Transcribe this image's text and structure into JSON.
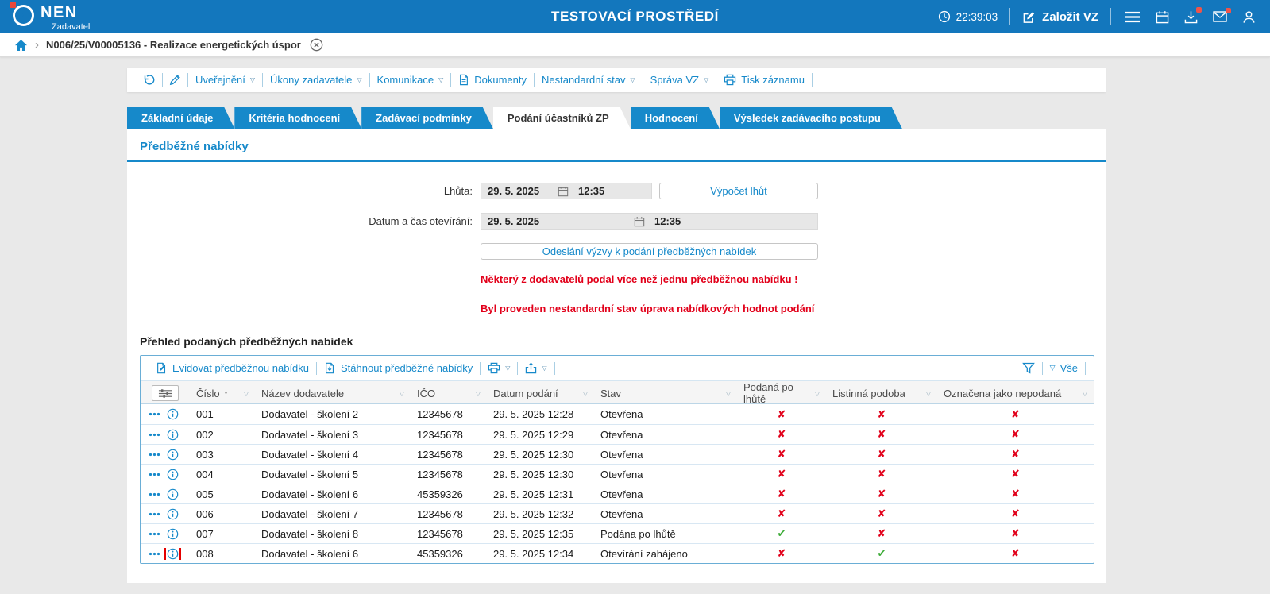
{
  "colors": {
    "header_bg": "#1377bd",
    "accent_blue": "#1689ca",
    "warning_red": "#e2001a",
    "check_green": "#3aaa35",
    "cross_red": "#e2001a",
    "highlight_box_red": "#e40000",
    "badge_red": "#f0544a"
  },
  "header": {
    "brand": "NEN",
    "brand_role": "Zadavatel",
    "environment_title": "TESTOVACÍ PROSTŘEDÍ",
    "clock": "22:39:03",
    "create_vz_label": "Založit VZ"
  },
  "breadcrumb": {
    "separator": "›",
    "record": "N006/25/V00005136 - Realizace energetických úspor"
  },
  "record_toolbar": {
    "items": [
      {
        "id": "uverejneni",
        "label": "Uveřejnění",
        "dropdown": true
      },
      {
        "id": "ukony-zadavatele",
        "label": "Úkony zadavatele",
        "dropdown": true
      },
      {
        "id": "komunikace",
        "label": "Komunikace",
        "dropdown": true
      },
      {
        "id": "dokumenty",
        "label": "Dokumenty",
        "icon": "document"
      },
      {
        "id": "nestandardni-stav",
        "label": "Nestandardní stav",
        "dropdown": true
      },
      {
        "id": "sprava-vz",
        "label": "Správa VZ",
        "dropdown": true
      },
      {
        "id": "tisk-zaznamu",
        "label": "Tisk záznamu",
        "icon": "printer"
      }
    ]
  },
  "tabs": [
    {
      "id": "zakladni-udaje",
      "label": "Základní údaje",
      "active": false
    },
    {
      "id": "kriteria-hodnoceni",
      "label": "Kritéria hodnocení",
      "active": false
    },
    {
      "id": "zadavaci-podminky",
      "label": "Zadávací podmínky",
      "active": false
    },
    {
      "id": "podani-ucastniku-zp",
      "label": "Podání účastníků ZP",
      "active": true
    },
    {
      "id": "hodnoceni",
      "label": "Hodnocení",
      "active": false
    },
    {
      "id": "vysledek-zadavaciho-postupu",
      "label": "Výsledek zadávacího postupu",
      "active": false
    }
  ],
  "preliminary_offers": {
    "section_title": "Předběžné nabídky",
    "deadline": {
      "label": "Lhůta:",
      "date": "29. 5. 2025",
      "time": "12:35"
    },
    "calc_deadlines_button": "Výpočet lhůt",
    "opening": {
      "label": "Datum a čas otevírání:",
      "date": "29. 5. 2025",
      "time": "12:35"
    },
    "send_call_button": "Odeslání výzvy k podání předběžných nabídek",
    "warnings": [
      "Některý z dodavatelů podal více než jednu předběžnou nabídku !",
      "Byl proveden nestandardní stav úprava nabídkových hodnot podání"
    ]
  },
  "offers_table": {
    "title": "Přehled podaných předběžných nabídek",
    "toolbar": {
      "register_label": "Evidovat předběžnou nabídku",
      "download_label": "Stáhnout předběžné nabídky",
      "all_label": "Vše"
    },
    "columns": [
      {
        "id": "cislo",
        "label": "Číslo",
        "sorted": "asc"
      },
      {
        "id": "nazev-dodavatele",
        "label": "Název dodavatele"
      },
      {
        "id": "ico",
        "label": "IČO"
      },
      {
        "id": "datum-podani",
        "label": "Datum podání"
      },
      {
        "id": "stav",
        "label": "Stav"
      },
      {
        "id": "podana-po-lhute",
        "label": "Podaná po lhůtě"
      },
      {
        "id": "listinna-podoba",
        "label": "Listinná podoba"
      },
      {
        "id": "oznacena-jako-nepodana",
        "label": "Označena jako nepodaná"
      }
    ],
    "rows": [
      {
        "number": "001",
        "supplier": "Dodavatel - školení 2",
        "ico": "12345678",
        "submitted": "29. 5. 2025 12:28",
        "status": "Otevřena",
        "late": false,
        "paper": false,
        "not_submitted": false
      },
      {
        "number": "002",
        "supplier": "Dodavatel - školení 3",
        "ico": "12345678",
        "submitted": "29. 5. 2025 12:29",
        "status": "Otevřena",
        "late": false,
        "paper": false,
        "not_submitted": false
      },
      {
        "number": "003",
        "supplier": "Dodavatel - školení 4",
        "ico": "12345678",
        "submitted": "29. 5. 2025 12:30",
        "status": "Otevřena",
        "late": false,
        "paper": false,
        "not_submitted": false
      },
      {
        "number": "004",
        "supplier": "Dodavatel - školení 5",
        "ico": "12345678",
        "submitted": "29. 5. 2025 12:30",
        "status": "Otevřena",
        "late": false,
        "paper": false,
        "not_submitted": false
      },
      {
        "number": "005",
        "supplier": "Dodavatel - školení 6",
        "ico": "45359326",
        "submitted": "29. 5. 2025 12:31",
        "status": "Otevřena",
        "late": false,
        "paper": false,
        "not_submitted": false
      },
      {
        "number": "006",
        "supplier": "Dodavatel - školení 7",
        "ico": "12345678",
        "submitted": "29. 5. 2025 12:32",
        "status": "Otevřena",
        "late": false,
        "paper": false,
        "not_submitted": false
      },
      {
        "number": "007",
        "supplier": "Dodavatel - školení 8",
        "ico": "12345678",
        "submitted": "29. 5. 2025 12:35",
        "status": "Podána po lhůtě",
        "late": true,
        "paper": false,
        "not_submitted": false
      },
      {
        "number": "008",
        "supplier": "Dodavatel - školení 6",
        "ico": "45359326",
        "submitted": "29. 5. 2025 12:34",
        "status": "Otevírání zahájeno",
        "late": false,
        "paper": true,
        "not_submitted": false,
        "info_highlighted": true
      }
    ]
  }
}
